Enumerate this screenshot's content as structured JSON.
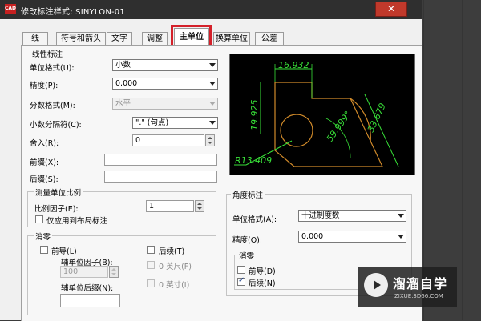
{
  "window": {
    "title": "修改标注样式: SINYLON-01",
    "close_label": "✕",
    "app_icon": "CAD"
  },
  "tabs": [
    {
      "label": "线"
    },
    {
      "label": "符号和箭头"
    },
    {
      "label": "文字"
    },
    {
      "label": "调整"
    },
    {
      "label": "主单位",
      "active": true
    },
    {
      "label": "换算单位"
    },
    {
      "label": "公差"
    }
  ],
  "linear": {
    "group_title": "线性标注",
    "unit_format_label": "单位格式(U):",
    "unit_format_value": "小数",
    "precision_label": "精度(P):",
    "precision_value": "0.000",
    "fraction_label": "分数格式(M):",
    "fraction_value": "水平",
    "decimal_sep_label": "小数分隔符(C):",
    "decimal_sep_value": "\".\" (句点)",
    "round_label": "舍入(R):",
    "round_value": "0",
    "prefix_label": "前缀(X):",
    "prefix_value": "",
    "suffix_label": "后缀(S):",
    "suffix_value": ""
  },
  "scale": {
    "group_title": "测量单位比例",
    "factor_label": "比例因子(E):",
    "factor_value": "1",
    "layout_only_label": "仅应用到布局标注"
  },
  "zero_linear": {
    "group_title": "消零",
    "leading_label": "前导(L)",
    "trailing_label": "后续(T)",
    "sub_factor_label": "辅单位因子(B):",
    "sub_factor_value": "100",
    "feet_label": "0 英尺(F)",
    "inches_label": "0 英寸(I)",
    "sub_suffix_label": "辅单位后缀(N):",
    "sub_suffix_value": ""
  },
  "angular": {
    "group_title": "角度标注",
    "unit_format_label": "单位格式(A):",
    "unit_format_value": "十进制度数",
    "precision_label": "精度(O):",
    "precision_value": "0.000",
    "zero_title": "消零",
    "leading_label": "前导(D)",
    "trailing_label": "后续(N)",
    "trailing_checked": true
  },
  "preview": {
    "dim_top": "16.932",
    "dim_left": "19.925",
    "dim_right": "33.679",
    "dim_angle": "59.999°",
    "dim_radius": "R13.409",
    "shape_color": "#d08a2a",
    "dim_color": "#38e038"
  },
  "watermark": {
    "title": "溜溜自学",
    "subtitle": "ZIXUE.3D66.COM"
  }
}
